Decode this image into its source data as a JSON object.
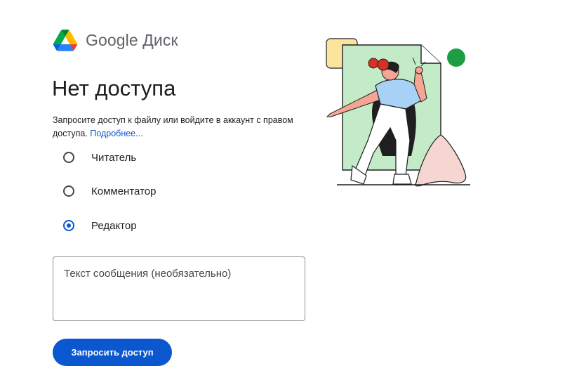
{
  "brand": {
    "name": "Google Диск",
    "logo_icon": "google-drive-logo-icon"
  },
  "page": {
    "title": "Нет доступа",
    "description": "Запросите доступ к файлу или войдите в аккаунт с правом доступа.",
    "learn_more_link": "Подробнее..."
  },
  "roles": {
    "options": [
      {
        "label": "Читатель",
        "checked": false
      },
      {
        "label": "Комментатор",
        "checked": false
      },
      {
        "label": "Редактор",
        "checked": true
      }
    ]
  },
  "message": {
    "placeholder": "Текст сообщения (необязательно)",
    "value": ""
  },
  "actions": {
    "request_button_label": "Запросить доступ"
  },
  "colors": {
    "accent": "#0b57d0",
    "drive_green": "#1e8e3e",
    "drive_yellow": "#fbbc04",
    "drive_blue": "#4285f4",
    "illustration_green_circle": "#1e9e44",
    "illustration_file_fill": "#c4ebc8",
    "illustration_yellow_card": "#fde49c",
    "illustration_pink_shape": "#f6d6d1"
  }
}
